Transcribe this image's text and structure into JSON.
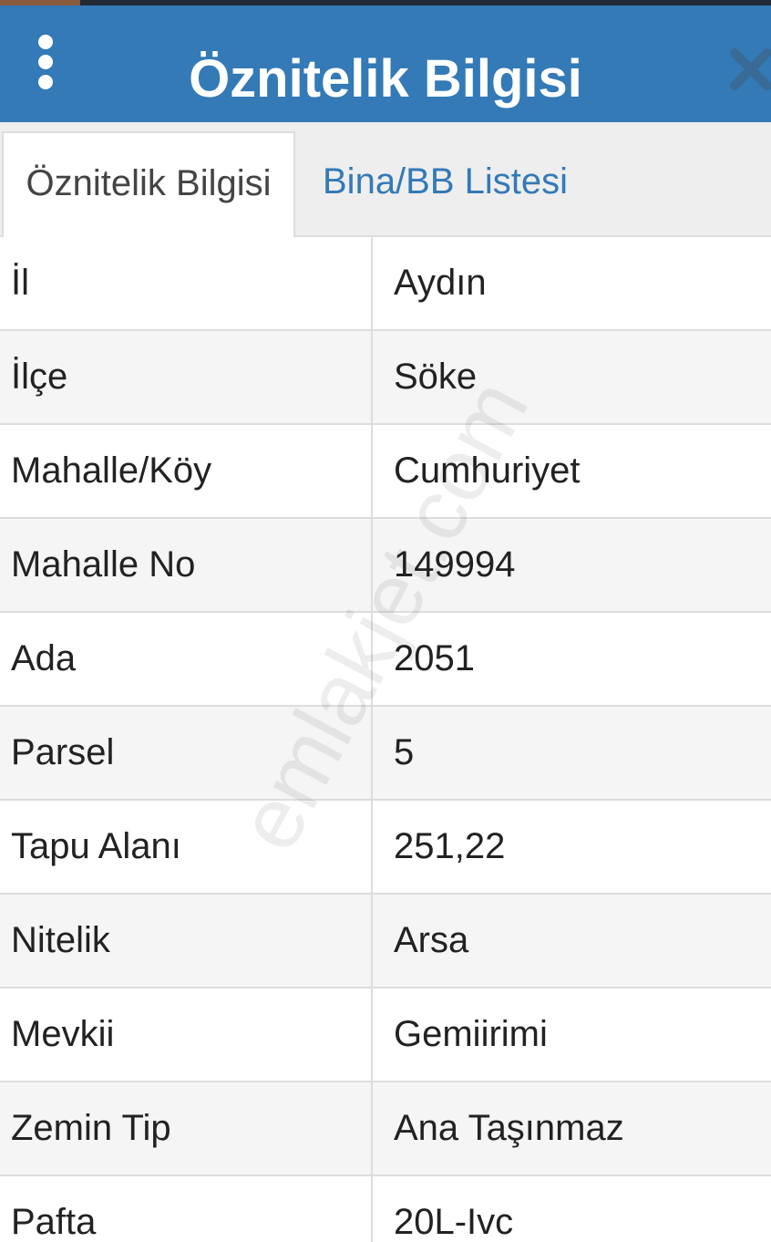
{
  "header": {
    "title": "Öznitelik Bilgisi",
    "menu_icon": "vertical-dots-icon",
    "close_icon": "close-icon",
    "background_color": "#337ab7"
  },
  "tabs": [
    {
      "label": "Öznitelik Bilgisi",
      "active": true
    },
    {
      "label": "Bina/BB Listesi",
      "active": false
    }
  ],
  "attributes": [
    {
      "label": "İl",
      "value": "Aydın"
    },
    {
      "label": "İlçe",
      "value": "Söke"
    },
    {
      "label": "Mahalle/Köy",
      "value": "Cumhuriyet"
    },
    {
      "label": "Mahalle No",
      "value": "149994"
    },
    {
      "label": "Ada",
      "value": "2051"
    },
    {
      "label": "Parsel",
      "value": "5"
    },
    {
      "label": "Tapu Alanı",
      "value": "251,22"
    },
    {
      "label": "Nitelik",
      "value": "Arsa"
    },
    {
      "label": "Mevkii",
      "value": "Gemiirimi"
    },
    {
      "label": "Zemin Tip",
      "value": "Ana Taşınmaz"
    },
    {
      "label": "Pafta",
      "value": "20L-Ivc"
    }
  ],
  "watermark": "emlakjet.com"
}
